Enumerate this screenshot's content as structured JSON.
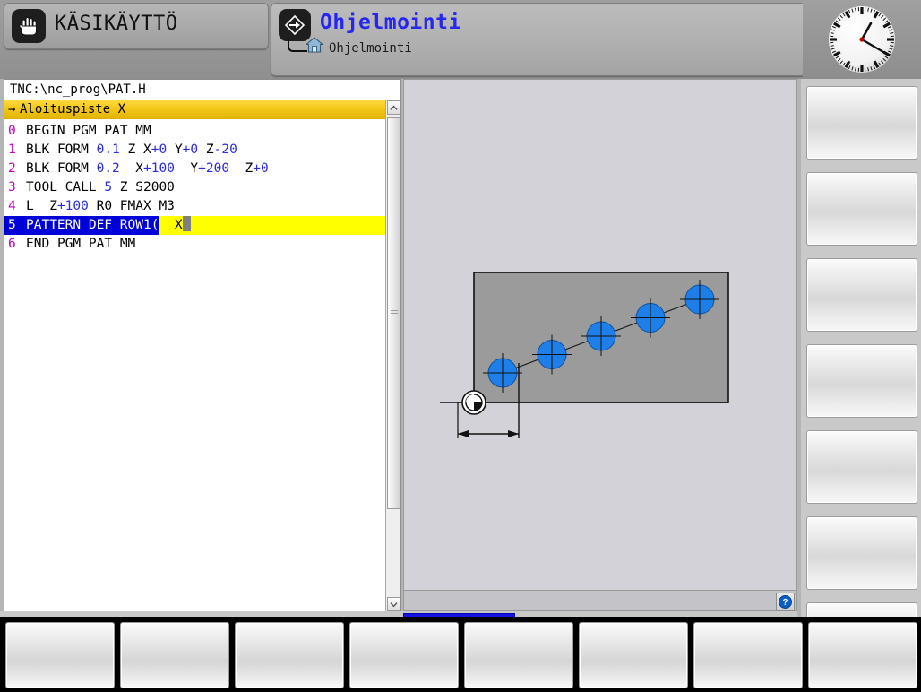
{
  "header": {
    "manual_mode": {
      "label": "KÄSIKÄYTTÖ",
      "icon": "hand-icon"
    },
    "programming_mode": {
      "label": "Ohjelmointi",
      "sublabel": "Ohjelmointi",
      "icon": "program-diamond-icon",
      "sub_icon": "home-icon",
      "label_color": "#2626ef"
    },
    "clock": {
      "icon": "analog-clock",
      "hour": 1,
      "minute": 20
    }
  },
  "program_pane": {
    "path": "TNC:\\nc_prog\\PAT.H",
    "prompt": {
      "arrow": "→",
      "text": "Aloituspiste X",
      "background": "#f2c718"
    },
    "lines": [
      {
        "n": "0",
        "text": "BEGIN PGM PAT MM",
        "selected": false
      },
      {
        "n": "1",
        "text": "BLK FORM 0.1 Z X+0 Y+0 Z-20",
        "selected": false
      },
      {
        "n": "2",
        "text": "BLK FORM 0.2  X+100  Y+200  Z+0",
        "selected": false
      },
      {
        "n": "3",
        "text": "TOOL CALL 5 Z S2000",
        "selected": false
      },
      {
        "n": "4",
        "text": "L  Z+100 R0 FMAX M3",
        "selected": false
      },
      {
        "n": "5",
        "text": "PATTERN DEF ROW1(",
        "selected": true,
        "field_value": "X",
        "has_caret": true
      },
      {
        "n": "6",
        "text": "END PGM PAT MM",
        "selected": false
      }
    ],
    "scrollbar": {
      "up_icon": "chevron-up-icon",
      "down_icon": "chevron-down-icon",
      "grip_icon": "grip-lines-icon"
    }
  },
  "graphics_pane": {
    "title": "pattern-help-graphic",
    "help_icon": "question-mark-icon",
    "blank_background": "#d2d2d8",
    "workpiece_fill": "#9b9b9b",
    "hole_fill": "#1f7fe8",
    "holes": 5,
    "datum_icon": "datum-origin-icon",
    "dimension_icon": "double-arrow-dimension"
  },
  "vertical_softkeys": [
    {
      "label": ""
    },
    {
      "label": ""
    },
    {
      "label": ""
    },
    {
      "label": ""
    },
    {
      "label": ""
    },
    {
      "label": ""
    },
    {
      "label": ""
    }
  ],
  "bottom_softkeys": [
    {
      "label": ""
    },
    {
      "label": ""
    },
    {
      "label": ""
    },
    {
      "label": ""
    },
    {
      "label": ""
    },
    {
      "label": ""
    },
    {
      "label": ""
    },
    {
      "label": ""
    }
  ]
}
